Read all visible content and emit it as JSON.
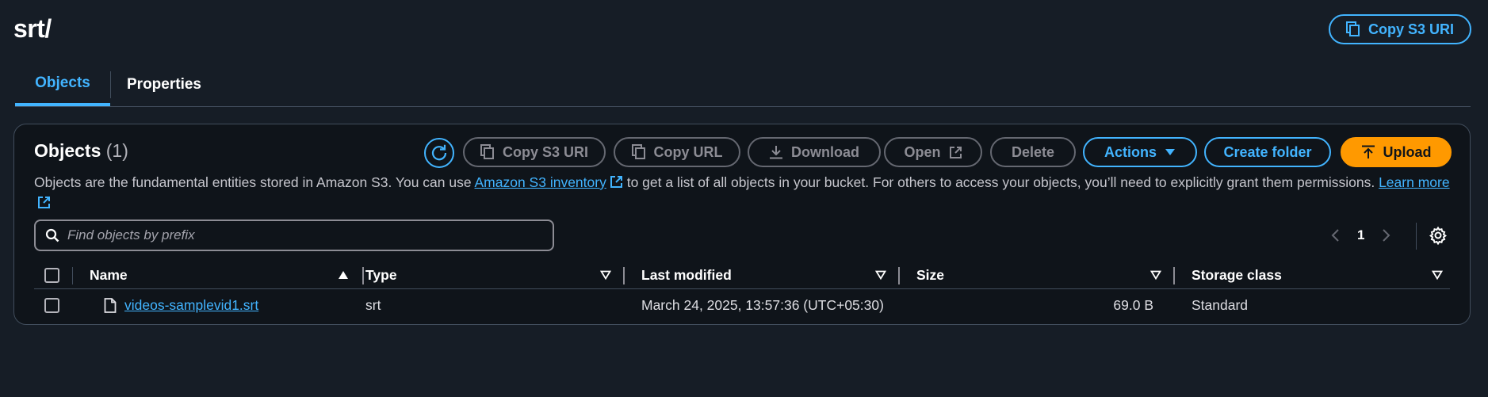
{
  "page": {
    "title": "srt/",
    "copy_s3_uri_label": "Copy S3 URI"
  },
  "tabs": [
    {
      "label": "Objects",
      "active": true
    },
    {
      "label": "Properties",
      "active": false
    }
  ],
  "objects_panel": {
    "title": "Objects",
    "count": "(1)",
    "toolbar": {
      "copy_s3_uri": "Copy S3 URI",
      "copy_url": "Copy URL",
      "download": "Download",
      "open": "Open",
      "delete": "Delete",
      "actions": "Actions",
      "create_folder": "Create folder",
      "upload": "Upload"
    },
    "description": {
      "part1": "Objects are the fundamental entities stored in Amazon S3. You can use ",
      "link1": "Amazon S3 inventory",
      "part2": " to get a list of all objects in your bucket. For others to access your objects, you’ll need to explicitly grant them permissions. ",
      "link2a": "Learn",
      "link2b": "more"
    },
    "search": {
      "placeholder": "Find objects by prefix",
      "value": ""
    },
    "pagination": {
      "current_page": "1"
    },
    "columns": {
      "name": "Name",
      "type": "Type",
      "last_modified": "Last modified",
      "size": "Size",
      "storage_class": "Storage class"
    },
    "rows": [
      {
        "name": "videos-samplevid1.srt",
        "type": "srt",
        "last_modified": "March 24, 2025, 13:57:36 (UTC+05:30)",
        "size": "69.0 B",
        "storage_class": "Standard"
      }
    ]
  },
  "colors": {
    "background": "#161d26",
    "accent": "#42b4ff",
    "upload": "#ff9900",
    "border": "#414d5c"
  },
  "icons": [
    "copy-icon",
    "refresh-icon",
    "download-icon",
    "external-link-icon",
    "caret-down-icon",
    "upload-icon",
    "search-icon",
    "chevron-left-icon",
    "chevron-right-icon",
    "gear-icon",
    "file-icon",
    "sort-ascending-icon",
    "sort-descending-icon"
  ]
}
